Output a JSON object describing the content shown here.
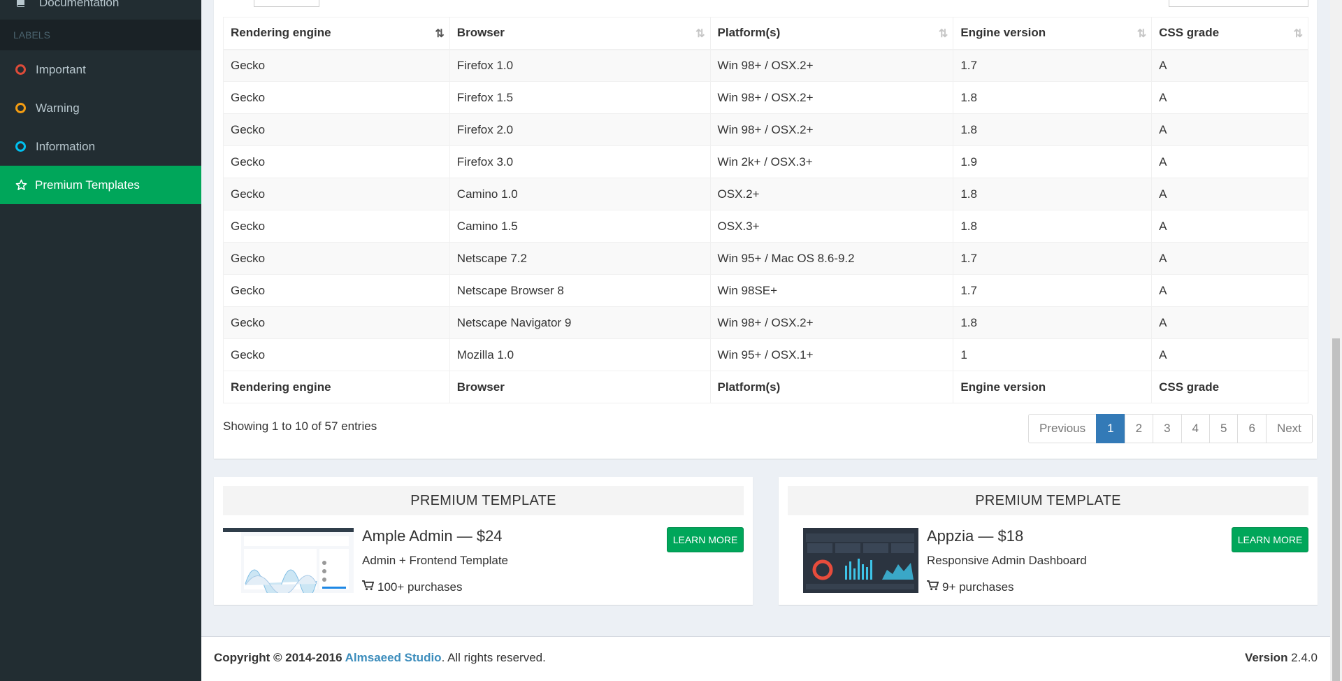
{
  "sidebar": {
    "doc_label": "Documentation",
    "labels_header": "LABELS",
    "labels": [
      {
        "label": "Important",
        "color": "#dd4b39"
      },
      {
        "label": "Warning",
        "color": "#f39c12"
      },
      {
        "label": "Information",
        "color": "#00c0ef"
      }
    ],
    "premium_label": "Premium Templates"
  },
  "table": {
    "headers": [
      "Rendering engine",
      "Browser",
      "Platform(s)",
      "Engine version",
      "CSS grade"
    ],
    "rows": [
      [
        "Gecko",
        "Firefox 1.0",
        "Win 98+ / OSX.2+",
        "1.7",
        "A"
      ],
      [
        "Gecko",
        "Firefox 1.5",
        "Win 98+ / OSX.2+",
        "1.8",
        "A"
      ],
      [
        "Gecko",
        "Firefox 2.0",
        "Win 98+ / OSX.2+",
        "1.8",
        "A"
      ],
      [
        "Gecko",
        "Firefox 3.0",
        "Win 2k+ / OSX.3+",
        "1.9",
        "A"
      ],
      [
        "Gecko",
        "Camino 1.0",
        "OSX.2+",
        "1.8",
        "A"
      ],
      [
        "Gecko",
        "Camino 1.5",
        "OSX.3+",
        "1.8",
        "A"
      ],
      [
        "Gecko",
        "Netscape 7.2",
        "Win 95+ / Mac OS 8.6-9.2",
        "1.7",
        "A"
      ],
      [
        "Gecko",
        "Netscape Browser 8",
        "Win 98SE+",
        "1.7",
        "A"
      ],
      [
        "Gecko",
        "Netscape Navigator 9",
        "Win 98+ / OSX.2+",
        "1.8",
        "A"
      ],
      [
        "Gecko",
        "Mozilla 1.0",
        "Win 95+ / OSX.1+",
        "1",
        "A"
      ]
    ],
    "info": "Showing 1 to 10 of 57 entries",
    "pagination": [
      "Previous",
      "1",
      "2",
      "3",
      "4",
      "5",
      "6",
      "Next"
    ],
    "active_page": "1"
  },
  "premium": [
    {
      "title": "PREMIUM TEMPLATE",
      "name": "Ample Admin — $24",
      "subtitle": "Admin + Frontend Template",
      "purchases": "100+ purchases",
      "button": "LEARN MORE"
    },
    {
      "title": "PREMIUM TEMPLATE",
      "name": "Appzia — $18",
      "subtitle": "Responsive Admin Dashboard",
      "purchases": "9+ purchases",
      "button": "LEARN MORE"
    }
  ],
  "footer": {
    "copyright_prefix": "Copyright © 2014-2016 ",
    "company": "Almsaeed Studio",
    "suffix": ". All rights reserved.",
    "version_label": "Version",
    "version_value": " 2.4.0"
  },
  "colors": {
    "accent": "#00a65a",
    "link": "#3c8dbc",
    "page_active": "#337ab7"
  }
}
